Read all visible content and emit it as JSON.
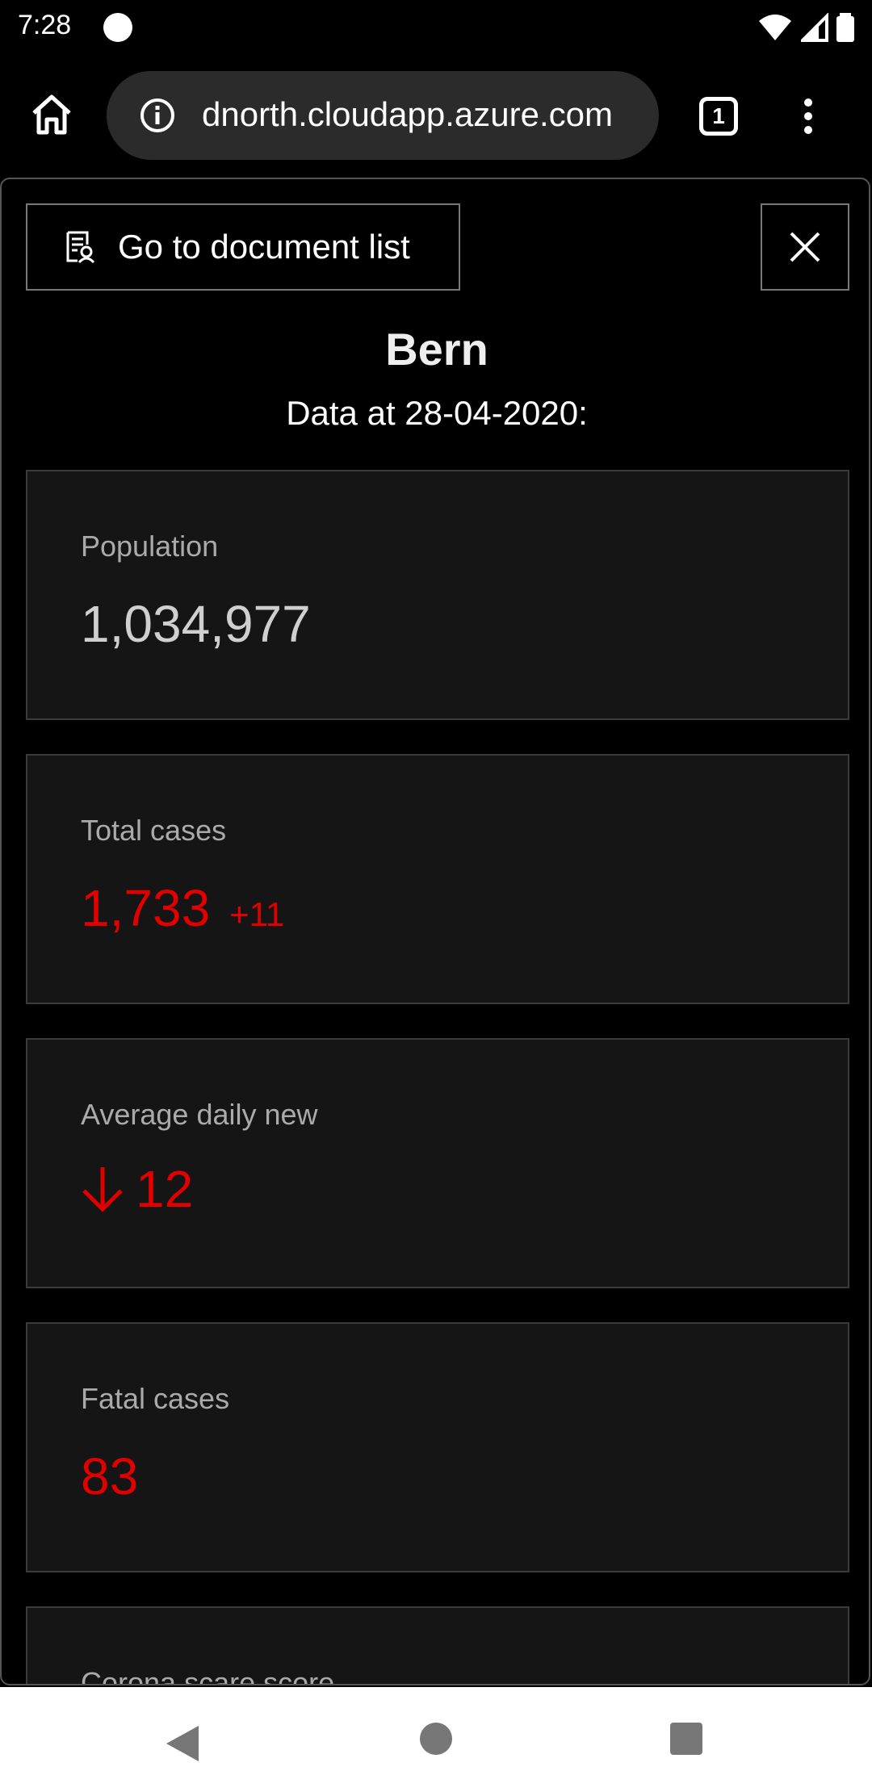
{
  "status_bar": {
    "time": "7:28"
  },
  "browser": {
    "url": "dnorth.cloudapp.azure.com",
    "tab_count": "1"
  },
  "page": {
    "doclist_button": "Go to document list",
    "title": "Bern",
    "subtitle": "Data at 28-04-2020:",
    "cards": [
      {
        "label": "Population",
        "value": "1,034,977"
      },
      {
        "label": "Total cases",
        "value": "1,733",
        "delta": "+11"
      },
      {
        "label": "Average daily new",
        "value": "12",
        "trend": "down"
      },
      {
        "label": "Fatal cases",
        "value": "83"
      },
      {
        "label": "Corona scare score"
      }
    ]
  },
  "colors": {
    "accent_red": "#e00000",
    "card_bg": "#151515"
  }
}
